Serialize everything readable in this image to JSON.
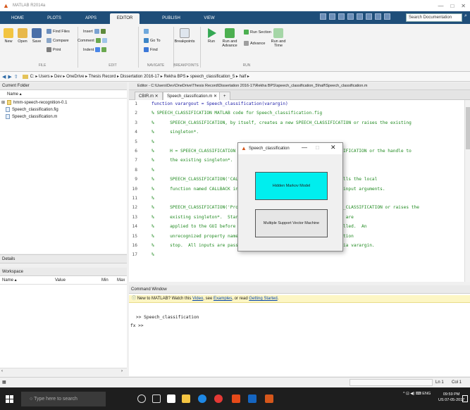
{
  "window": {
    "title": "MATLAB R2014a",
    "min": "—",
    "max": "□",
    "close": "✕"
  },
  "ribbon_tabs": [
    "HOME",
    "PLOTS",
    "APPS",
    "EDITOR",
    "PUBLISH",
    "VIEW"
  ],
  "search_placeholder": "Search Documentation",
  "ribbon": {
    "new": "New",
    "open": "Open",
    "save": "Save",
    "find_files": "Find Files",
    "compare": "Compare",
    "print": "Print",
    "insert": "Insert",
    "comment": "Comment",
    "indent": "Indent",
    "goto": "Go To",
    "find": "Find",
    "breakpoints": "Breakpoints",
    "run": "Run",
    "run_and_advance": "Run and Advance",
    "run_section": "Run Section",
    "advance": "Advance",
    "run_and_time": "Run and Time",
    "sections": [
      "FILE",
      "EDIT",
      "NAVIGATE",
      "BREAKPOINTS",
      "RUN"
    ]
  },
  "address": {
    "parts": [
      "C:",
      "Users",
      "Dev",
      "OneDrive",
      "Thesis Record",
      "Dissertation 2016-17",
      "Rekha BPS",
      "speech_classification_5",
      "half"
    ]
  },
  "current_folder": {
    "title": "Current Folder",
    "column": "Name ▴",
    "items": [
      "hmm-speech-recognition-0.1",
      "Speech_classification.fig",
      "Speech_classification.m"
    ]
  },
  "details": "Details",
  "workspace": {
    "title": "Workspace",
    "cols": [
      "Name ▴",
      "Value",
      "Min",
      "Max"
    ]
  },
  "editor": {
    "path": "Editor - C:\\Users\\Dev\\OneDrive\\Thesis Record\\Dissertation 2016-17\\Rekha BPS\\speech_classification_5\\half\\Speech_classification.m",
    "tabs": [
      "CBIR.m",
      "Speech_classification.m",
      "+"
    ],
    "lines": [
      {
        "n": "1",
        "t": "function varargout = Speech_classification(varargin)",
        "kw": true
      },
      {
        "n": "2",
        "t": "% SPEECH_CLASSIFICATION MATLAB code for Speech_classification.fig"
      },
      {
        "n": "3",
        "t": "%      SPEECH_CLASSIFICATION, by itself, creates a new SPEECH_CLASSIFICATION or raises the existing"
      },
      {
        "n": "4",
        "t": "%      singleton*."
      },
      {
        "n": "5",
        "t": "%"
      },
      {
        "n": "6",
        "t": "%      H = SPEECH_CLASSIFICATION returns the handle to a new SPEECH_CLASSIFICATION or the handle to"
      },
      {
        "n": "7",
        "t": "%      the existing singleton*."
      },
      {
        "n": "8",
        "t": "%"
      },
      {
        "n": "9",
        "t": "%      SPEECH_CLASSIFICATION('CALLBACK',hObject,eventData,handles,...) calls the local"
      },
      {
        "n": "10",
        "t": "%      function named CALLBACK in SPEECH_CLASSIFICATION.M with the given input arguments."
      },
      {
        "n": "11",
        "t": "%"
      },
      {
        "n": "12",
        "t": "%      SPEECH_CLASSIFICATION('Property','Value',...) creates a new SPEECH_CLASSIFICATION or raises the"
      },
      {
        "n": "13",
        "t": "%      existing singleton*.  Starting from the left, property value pairs are"
      },
      {
        "n": "14",
        "t": "%      applied to the GUI before Speech_classification_OpeningFcn gets called.  An"
      },
      {
        "n": "15",
        "t": "%      unrecognized property name or invalid value makes property application"
      },
      {
        "n": "16",
        "t": "%      stop.  All inputs are passed to Speech_classification_OpeningFcn via varargin."
      },
      {
        "n": "17",
        "t": "%"
      }
    ]
  },
  "command_window": {
    "title": "Command Window",
    "notice_prefix": "New to MATLAB? Watch this ",
    "video": "Video",
    "mid1": ", see ",
    "examples": "Examples",
    "mid2": ", or read ",
    "getting_started": "Getting Started",
    "suffix": ".",
    "line1": ">> Speech_classification",
    "line2": "fx >>"
  },
  "status": {
    "ln": "Ln 1",
    "col": "Col 1"
  },
  "taskbar": {
    "search": "Type here to search",
    "tray": "^  ⊡  ◀) ⌨  ENG",
    "time": "09:59 PM",
    "locale": "US",
    "date": "07-05-2017"
  },
  "dialog": {
    "title": "Speech_classification",
    "btn_hmm": "Hidden Markov Model",
    "btn_svm": "Multiple Support Vector Machine"
  }
}
